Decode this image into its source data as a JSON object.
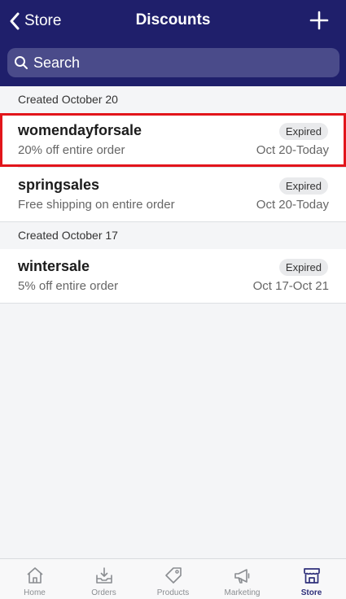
{
  "header": {
    "back_label": "Store",
    "title": "Discounts",
    "search_placeholder": "Search"
  },
  "sections": [
    {
      "label": "Created October 20",
      "items": [
        {
          "code": "womendayforsale",
          "description": "20% off entire order",
          "status": "Expired",
          "dates": "Oct 20-Today"
        },
        {
          "code": "springsales",
          "description": "Free shipping on entire order",
          "status": "Expired",
          "dates": "Oct 20-Today"
        }
      ]
    },
    {
      "label": "Created October 17",
      "items": [
        {
          "code": "wintersale",
          "description": "5% off entire order",
          "status": "Expired",
          "dates": "Oct 17-Oct 21"
        }
      ]
    }
  ],
  "tabs": [
    {
      "label": "Home",
      "icon": "home-icon"
    },
    {
      "label": "Orders",
      "icon": "orders-icon"
    },
    {
      "label": "Products",
      "icon": "tag-icon"
    },
    {
      "label": "Marketing",
      "icon": "megaphone-icon"
    },
    {
      "label": "Store",
      "icon": "store-icon",
      "active": true
    }
  ],
  "colors": {
    "header_bg": "#1f1f6b",
    "search_bg": "#4a4b8a",
    "highlight": "#e2151b",
    "active_tab": "#2e2f7a"
  }
}
